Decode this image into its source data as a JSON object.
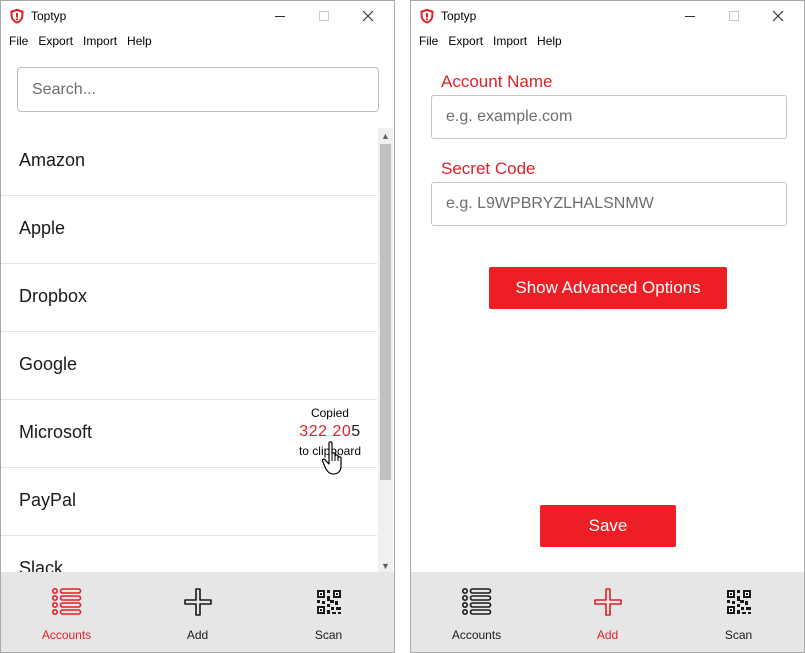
{
  "app": {
    "title": "Toptyp"
  },
  "menu": [
    "File",
    "Export",
    "Import",
    "Help"
  ],
  "colors": {
    "accent": "#e21f26",
    "nav_bg": "#e6e6e6"
  },
  "accounts_view": {
    "search_placeholder": "Search...",
    "accounts": [
      "Amazon",
      "Apple",
      "Dropbox",
      "Google",
      "Microsoft",
      "PayPal",
      "Slack"
    ],
    "copied": {
      "account": "Microsoft",
      "top_text": "Copied",
      "code_highlight": "322 20",
      "code_rest": "5",
      "bottom_text": "to clipboard"
    }
  },
  "add_view": {
    "account_name_label": "Account Name",
    "account_name_placeholder": "e.g. example.com",
    "secret_code_label": "Secret Code",
    "secret_code_placeholder": "e.g. L9WPBRYZLHALSNMW",
    "advanced_button": "Show Advanced Options",
    "save_button": "Save"
  },
  "nav": [
    {
      "label": "Accounts",
      "icon": "list-icon"
    },
    {
      "label": "Add",
      "icon": "plus-icon"
    },
    {
      "label": "Scan",
      "icon": "qr-code-icon"
    }
  ],
  "left_window": {
    "active_nav": "Accounts"
  },
  "right_window": {
    "active_nav": "Add"
  }
}
